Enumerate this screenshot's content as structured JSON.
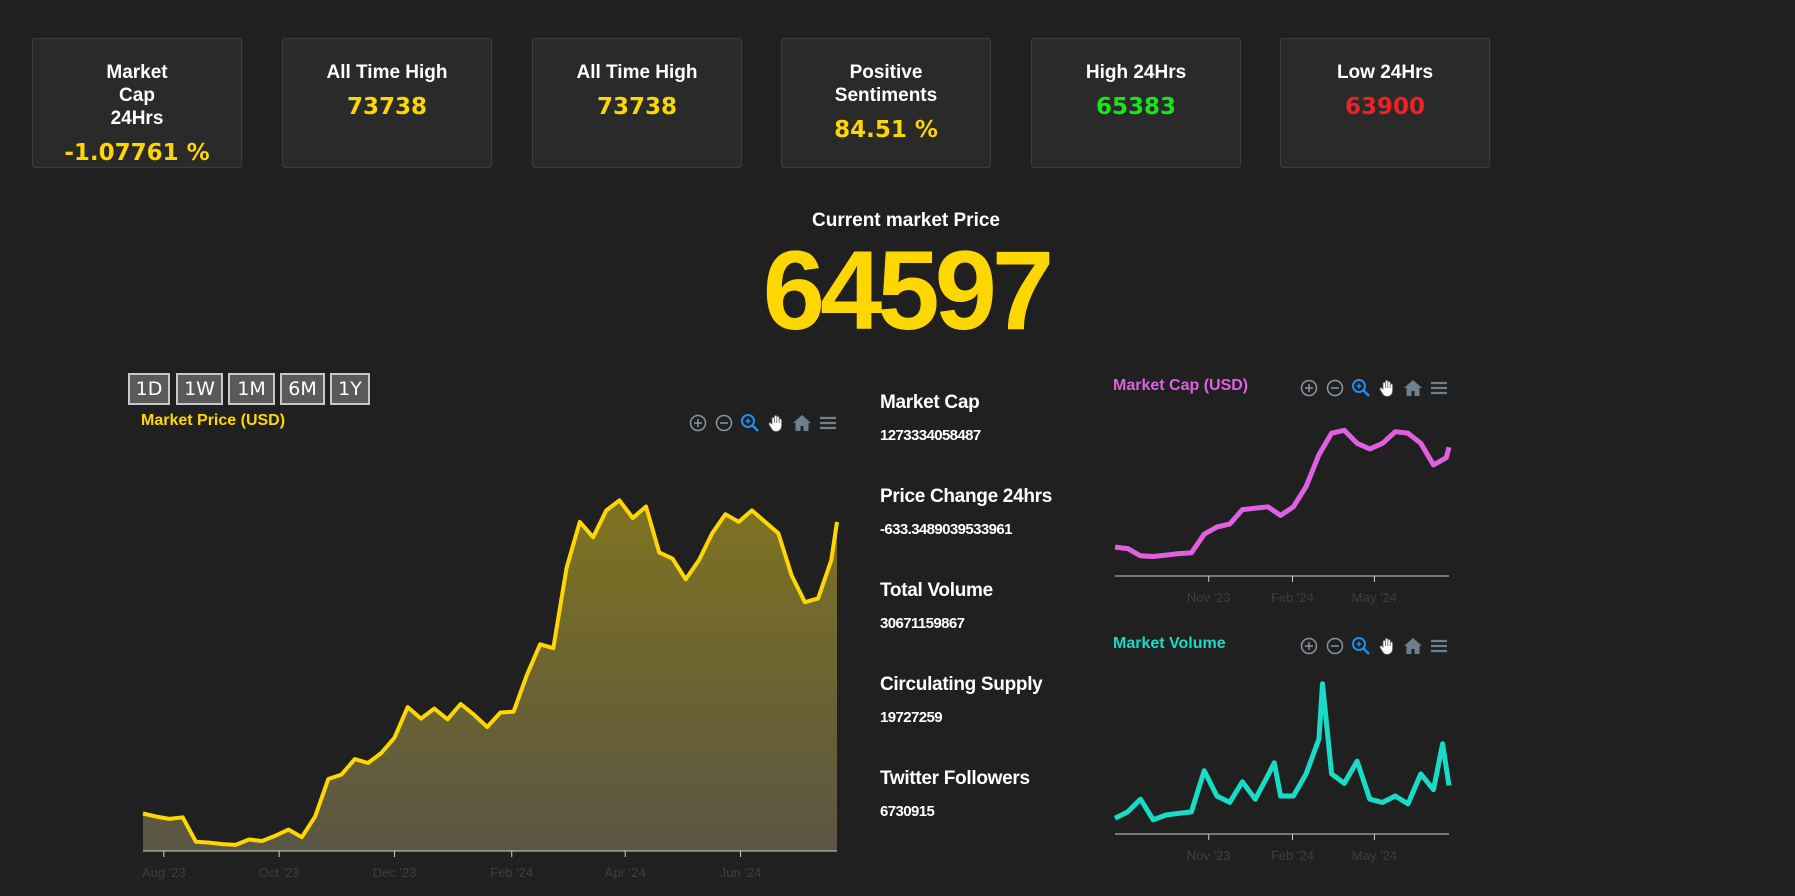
{
  "cards": [
    {
      "title": "Market Cap 24Hrs",
      "value": "-1.07761 %",
      "color": "#ffd700"
    },
    {
      "title": "All Time High",
      "value": "73738",
      "color": "#ffd700"
    },
    {
      "title": "All Time High",
      "value": "73738",
      "color": "#ffd700"
    },
    {
      "title": "Positive Sentiments",
      "value": "84.51 %",
      "color": "#ffd700"
    },
    {
      "title": "High 24Hrs",
      "value": "65383",
      "color": "#19e619"
    },
    {
      "title": "Low 24Hrs",
      "value": "63900",
      "color": "#ee2222"
    }
  ],
  "current": {
    "label": "Current market Price",
    "price": "64597"
  },
  "ranges": [
    "1D",
    "1W",
    "1M",
    "6M",
    "1Y"
  ],
  "stats": [
    {
      "label": "Market Cap",
      "value": "1273334058487"
    },
    {
      "label": "Price Change 24hrs",
      "value": "-633.3489039533961"
    },
    {
      "label": "Total Volume",
      "value": "30671159867"
    },
    {
      "label": "Circulating Supply",
      "value": "19727259"
    },
    {
      "label": "Twitter Followers",
      "value": "6730915"
    }
  ],
  "toolbar_icons": [
    "zoom-in-icon",
    "zoom-out-icon",
    "zoom-select-icon",
    "pan-hand-icon",
    "home-icon",
    "menu-icon"
  ],
  "chart_data": [
    {
      "type": "area",
      "title": "Market Price (USD)",
      "color": "#ffd700",
      "x_ticks": [
        "Aug '23",
        "Oct '23",
        "Dec '23",
        "Feb '24",
        "Apr '24",
        "Jun '24"
      ],
      "ylim": [
        25000,
        80000
      ],
      "x": [
        "2023-07-21",
        "2023-07-28",
        "2023-08-04",
        "2023-08-11",
        "2023-08-18",
        "2023-08-25",
        "2023-09-01",
        "2023-09-08",
        "2023-09-15",
        "2023-09-22",
        "2023-09-29",
        "2023-10-06",
        "2023-10-13",
        "2023-10-20",
        "2023-10-27",
        "2023-11-03",
        "2023-11-10",
        "2023-11-17",
        "2023-11-24",
        "2023-12-01",
        "2023-12-08",
        "2023-12-15",
        "2023-12-22",
        "2023-12-29",
        "2024-01-05",
        "2024-01-12",
        "2024-01-19",
        "2024-01-26",
        "2024-02-02",
        "2024-02-09",
        "2024-02-16",
        "2024-02-23",
        "2024-03-01",
        "2024-03-08",
        "2024-03-15",
        "2024-03-22",
        "2024-03-29",
        "2024-04-05",
        "2024-04-12",
        "2024-04-19",
        "2024-04-26",
        "2024-05-03",
        "2024-05-10",
        "2024-05-17",
        "2024-05-24",
        "2024-05-31",
        "2024-06-07",
        "2024-06-14",
        "2024-06-21",
        "2024-06-28",
        "2024-07-05",
        "2024-07-12",
        "2024-07-19",
        "2024-07-22"
      ],
      "values": [
        29900,
        29500,
        29200,
        29400,
        26200,
        26100,
        25900,
        25800,
        26500,
        26300,
        27000,
        27800,
        26800,
        29500,
        34400,
        35000,
        37000,
        36500,
        37800,
        39800,
        43800,
        42300,
        43600,
        42200,
        44200,
        42800,
        41200,
        43100,
        43200,
        48000,
        52000,
        51500,
        62000,
        68000,
        66000,
        69500,
        70800,
        68500,
        70000,
        64000,
        63200,
        60500,
        63000,
        66500,
        69000,
        68000,
        69500,
        68000,
        66500,
        61000,
        57500,
        58000,
        63000,
        68000
      ]
    },
    {
      "type": "line",
      "title": "Market Cap (USD)",
      "color": "#e060e0",
      "x_ticks": [
        "Nov '23",
        "Feb '24",
        "May '24"
      ],
      "ylim": [
        380000000000,
        1600000000000
      ],
      "x": [
        "2023-07-21",
        "2023-08-04",
        "2023-08-18",
        "2023-09-01",
        "2023-09-15",
        "2023-09-29",
        "2023-10-13",
        "2023-10-27",
        "2023-11-10",
        "2023-11-24",
        "2023-12-08",
        "2023-12-22",
        "2024-01-05",
        "2024-01-19",
        "2024-02-02",
        "2024-02-16",
        "2024-03-01",
        "2024-03-15",
        "2024-03-29",
        "2024-04-12",
        "2024-04-26",
        "2024-05-10",
        "2024-05-24",
        "2024-06-07",
        "2024-06-21",
        "2024-07-05",
        "2024-07-19",
        "2024-07-22"
      ],
      "values": [
        580000000000,
        570000000000,
        520000000000,
        515000000000,
        525000000000,
        535000000000,
        540000000000,
        670000000000,
        720000000000,
        740000000000,
        840000000000,
        850000000000,
        860000000000,
        800000000000,
        860000000000,
        1000000000000,
        1220000000000,
        1370000000000,
        1390000000000,
        1300000000000,
        1260000000000,
        1300000000000,
        1380000000000,
        1370000000000,
        1300000000000,
        1150000000000,
        1200000000000,
        1273000000000
      ]
    },
    {
      "type": "line",
      "title": "Market Volume",
      "color": "#18dcc8",
      "x_ticks": [
        "Nov '23",
        "Feb '24",
        "May '24"
      ],
      "ylim": [
        0,
        110000000000
      ],
      "x": [
        "2023-07-21",
        "2023-08-04",
        "2023-08-18",
        "2023-09-01",
        "2023-09-15",
        "2023-09-29",
        "2023-10-13",
        "2023-10-27",
        "2023-11-10",
        "2023-11-24",
        "2023-12-08",
        "2023-12-22",
        "2024-01-05",
        "2024-01-12",
        "2024-01-19",
        "2024-02-02",
        "2024-02-16",
        "2024-03-01",
        "2024-03-05",
        "2024-03-15",
        "2024-03-29",
        "2024-04-12",
        "2024-04-26",
        "2024-05-10",
        "2024-05-24",
        "2024-06-07",
        "2024-06-21",
        "2024-07-05",
        "2024-07-15",
        "2024-07-22"
      ],
      "values": [
        10000000000,
        14000000000,
        22000000000,
        9000000000,
        12000000000,
        13000000000,
        14000000000,
        40000000000,
        24000000000,
        20000000000,
        33000000000,
        22000000000,
        37000000000,
        45000000000,
        24000000000,
        24000000000,
        38000000000,
        60000000000,
        95000000000,
        38000000000,
        32000000000,
        46000000000,
        22000000000,
        20000000000,
        24000000000,
        19000000000,
        38000000000,
        28000000000,
        57000000000,
        30671159867
      ]
    }
  ]
}
